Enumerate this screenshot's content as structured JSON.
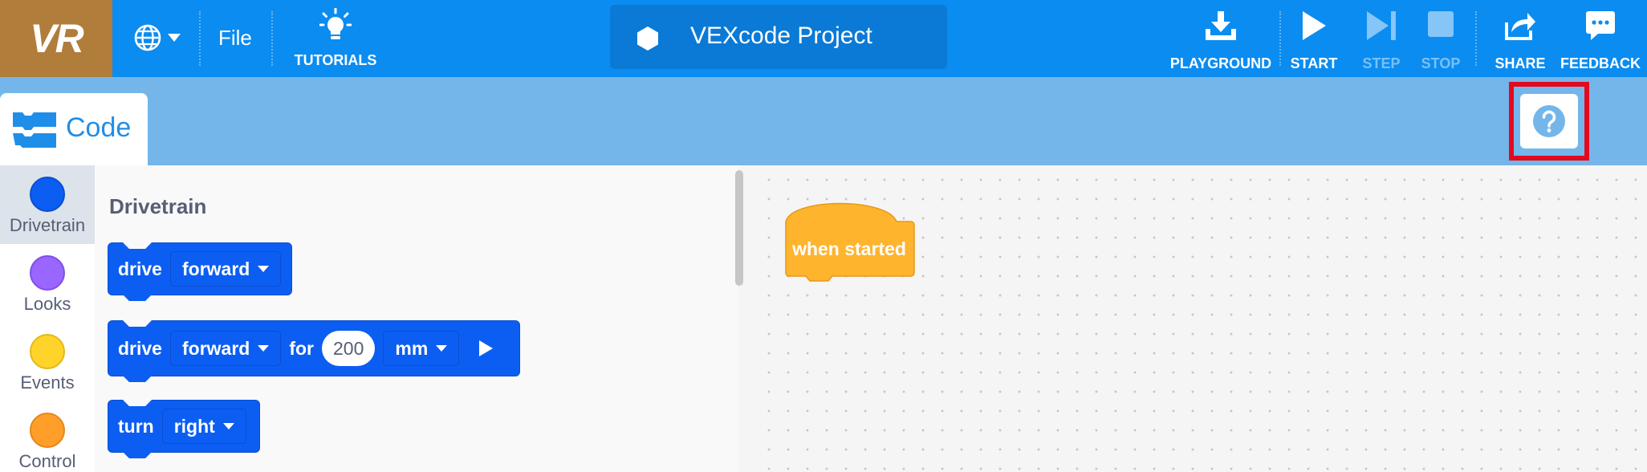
{
  "app": {
    "logo_text": "VR",
    "project_name": "VEXcode Project"
  },
  "menu": {
    "file_label": "File",
    "tutorials_label": "TUTORIALS"
  },
  "toolbar": {
    "playground_label": "PLAYGROUND",
    "start_label": "START",
    "step_label": "STEP",
    "stop_label": "STOP",
    "share_label": "SHARE",
    "feedback_label": "FEEDBACK"
  },
  "tabs": {
    "code_label": "Code"
  },
  "categories": [
    {
      "label": "Drivetrain",
      "color": "#0c5ef2"
    },
    {
      "label": "Looks",
      "color": "#9966ff"
    },
    {
      "label": "Events",
      "color": "#ffd42a"
    },
    {
      "label": "Control",
      "color": "#ff9f2a"
    }
  ],
  "flyout": {
    "section_title": "Drivetrain",
    "blocks": [
      {
        "word": "drive",
        "dropdown": "forward"
      },
      {
        "word": "drive",
        "dropdown": "forward",
        "for_word": "for",
        "amount": "200",
        "unit": "mm"
      },
      {
        "word": "turn",
        "dropdown": "right"
      }
    ]
  },
  "workspace": {
    "hat_block_label": "when started",
    "hat_color": "#ffb42e"
  },
  "colors": {
    "topbar": "#0b8cf0",
    "tabbar": "#74b6ea",
    "logo_bg": "#b07d3b",
    "highlight": "#e3091f",
    "drivetrain_block": "#0c5ef2"
  }
}
